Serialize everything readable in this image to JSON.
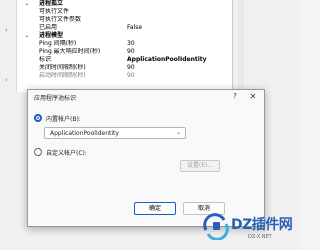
{
  "property_grid": {
    "rows": [
      {
        "kind": "section",
        "toggle": "⌄",
        "name": "进程孤立",
        "value": ""
      },
      {
        "kind": "prop",
        "name": "可执行文件",
        "value": ""
      },
      {
        "kind": "prop",
        "name": "可执行文件参数",
        "value": ""
      },
      {
        "kind": "prop",
        "name": "已启用",
        "value": "False"
      },
      {
        "kind": "section",
        "toggle": "⌄",
        "name": "进程模型",
        "value": ""
      },
      {
        "kind": "prop",
        "name": "Ping 间隔(秒)",
        "value": "30"
      },
      {
        "kind": "prop",
        "name": "Ping 最大响应时间(秒)",
        "value": "90"
      },
      {
        "kind": "prop",
        "name": "标识",
        "value": "ApplicationPoolIdentity"
      },
      {
        "kind": "prop",
        "name": "关闭时间限制(秒)",
        "value": "90"
      },
      {
        "kind": "prop",
        "name": "启动时间限制(秒)",
        "value": "90"
      }
    ]
  },
  "dialog": {
    "title": "应用程序池标识",
    "help_icon": "?",
    "close_icon": "✕",
    "builtin_label": "内置帐户(B):",
    "builtin_value": "ApplicationPoolIdentity",
    "custom_label": "自定义帐户(C):",
    "set_button": "设置(E)...",
    "ok_button": "确定",
    "cancel_button": "取消"
  },
  "watermark": {
    "title": "DZ插件网",
    "subtitle": "DZ-X.NET"
  },
  "colors": {
    "accent": "#1060c8",
    "watermark": "#2b5fb4"
  }
}
